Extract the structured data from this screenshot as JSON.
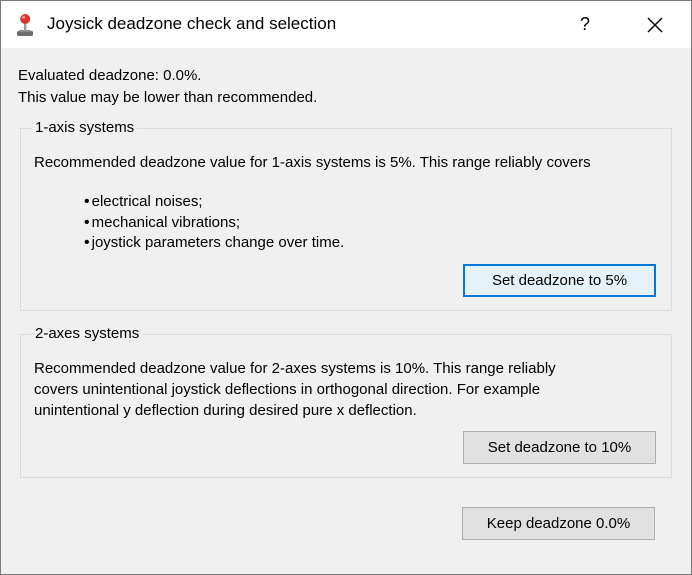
{
  "window": {
    "title": "Joysick deadzone check and selection",
    "help_label": "?",
    "app_icon": "joystick-icon",
    "close_icon": "close-icon"
  },
  "status": {
    "evaluated": "Evaluated deadzone: 0.0%.",
    "warning": "This value may be lower than recommended."
  },
  "one_axis": {
    "group_title": "1-axis systems",
    "description": "Recommended deadzone value for 1-axis systems is 5%. This range reliably covers",
    "bullets": [
      "electrical noises;",
      "mechanical vibrations;",
      "joystick parameters change over time."
    ],
    "button_label": "Set deadzone to 5%"
  },
  "two_axes": {
    "group_title": "2-axes systems",
    "description_lines": [
      "Recommended deadzone value for 2-axes systems is 10%. This range reliably",
      "covers unintentional joystick deflections in orthogonal direction. For example",
      "unintentional y deflection during desired pure x deflection."
    ],
    "button_label": "Set deadzone to 10%"
  },
  "keep_button_label": "Keep deadzone 0.0%",
  "colors": {
    "window_bg": "#f0f0f0",
    "titlebar_bg": "#ffffff",
    "default_button_border": "#0078d7",
    "default_button_bg": "#e5f1fb",
    "button_bg": "#e1e1e1"
  }
}
